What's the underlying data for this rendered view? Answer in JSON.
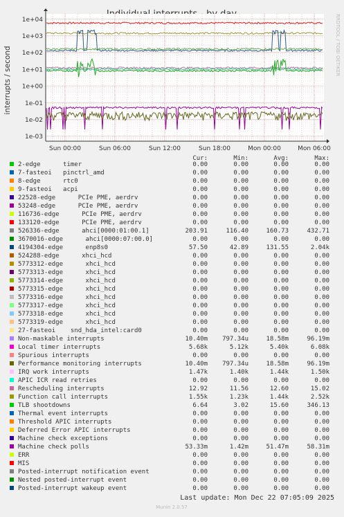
{
  "chart_data": {
    "type": "line",
    "title": "Individual interrupts - by day",
    "ylabel": "interrupts / second",
    "side_label": "RRDTOOL / TOBI OETIKER",
    "yscale": "log",
    "ylim": [
      0.0005,
      20000
    ],
    "y_ticks": [
      {
        "v": 10000,
        "label": "1e+04"
      },
      {
        "v": 1000,
        "label": "1e+03"
      },
      {
        "v": 100,
        "label": "1e+02"
      },
      {
        "v": 10,
        "label": "1e+01"
      },
      {
        "v": 1,
        "label": "1e+00"
      },
      {
        "v": 0.1,
        "label": "1e-01"
      },
      {
        "v": 0.01,
        "label": "1e-02"
      },
      {
        "v": 0.001,
        "label": "1e-03"
      }
    ],
    "x_ticks": [
      "Sun 00:00",
      "Sun 06:00",
      "Sun 12:00",
      "Sun 18:00",
      "Mon 00:00",
      "Mon 06:00"
    ],
    "grid": true,
    "series": [
      {
        "name": "Local timer interrupts",
        "color": "#e41a1c",
        "y_level": 5700
      },
      {
        "name": "Function call interrupts",
        "color": "#999933",
        "y_level": 1400
      },
      {
        "name": "enp8s0",
        "color": "#2a5890",
        "y_level": 130,
        "spike_to": 2000
      },
      {
        "name": "ahci[0000:01:00.1]",
        "color": "#66aa55",
        "y_level": 160
      },
      {
        "name": "Rescheduling interrupts",
        "color": "#c070a0",
        "y_level": 12
      },
      {
        "name": "TLB shootdowns",
        "color": "#33cc99",
        "y_level": 10
      },
      {
        "name": "Posted-interrupt notification event",
        "color": "#22aa22",
        "y_level": 8
      },
      {
        "name": "Machine check polls",
        "color": "#990099",
        "y_level": 0.05
      },
      {
        "name": "Performance monitoring interrupts",
        "color": "#666622",
        "y_level": 0.018
      }
    ]
  },
  "legend": {
    "headers": {
      "cur": "Cur:",
      "min": "Min:",
      "avg": "Avg:",
      "max": "Max:"
    },
    "rows": [
      {
        "label": "2-edge      timer",
        "color": "#00cc00",
        "cur": "0.00",
        "min": "0.00",
        "avg": "0.00",
        "max": "0.00"
      },
      {
        "label": "7-fasteoi   pinctrl_amd",
        "color": "#0066b3",
        "cur": "0.00",
        "min": "0.00",
        "avg": "0.00",
        "max": "0.00"
      },
      {
        "label": "8-edge      rtc0",
        "color": "#ff8000",
        "cur": "0.00",
        "min": "0.00",
        "avg": "0.00",
        "max": "0.00"
      },
      {
        "label": "9-fasteoi   acpi",
        "color": "#ffcc00",
        "cur": "0.00",
        "min": "0.00",
        "avg": "0.00",
        "max": "0.00"
      },
      {
        "label": "22528-edge      PCIe PME, aerdrv",
        "color": "#330099",
        "cur": "0.00",
        "min": "0.00",
        "avg": "0.00",
        "max": "0.00"
      },
      {
        "label": "53248-edge      PCIe PME, aerdrv",
        "color": "#990099",
        "cur": "0.00",
        "min": "0.00",
        "avg": "0.00",
        "max": "0.00"
      },
      {
        "label": "116736-edge      PCIe PME, aerdrv",
        "color": "#ccff00",
        "cur": "0.00",
        "min": "0.00",
        "avg": "0.00",
        "max": "0.00"
      },
      {
        "label": "133120-edge      PCIe PME, aerdrv",
        "color": "#ff0000",
        "cur": "0.00",
        "min": "0.00",
        "avg": "0.00",
        "max": "0.00"
      },
      {
        "label": "526336-edge      ahci[0000:01:00.1]",
        "color": "#808080",
        "cur": "203.91",
        "min": "116.40",
        "avg": "160.73",
        "max": "432.71"
      },
      {
        "label": "3670016-edge      ahci[0000:07:00.0]",
        "color": "#008f00",
        "cur": "0.00",
        "min": "0.00",
        "avg": "0.00",
        "max": "0.00"
      },
      {
        "label": "4194304-edge      enp8s0",
        "color": "#00487d",
        "cur": "57.50",
        "min": "42.89",
        "avg": "131.55",
        "max": "2.04k"
      },
      {
        "label": "524288-edge      xhci_hcd",
        "color": "#b35a00",
        "cur": "0.00",
        "min": "0.00",
        "avg": "0.00",
        "max": "0.00"
      },
      {
        "label": "5773312-edge      xhci_hcd",
        "color": "#b38f00",
        "cur": "0.00",
        "min": "0.00",
        "avg": "0.00",
        "max": "0.00"
      },
      {
        "label": "5773313-edge      xhci_hcd",
        "color": "#6b006b",
        "cur": "0.00",
        "min": "0.00",
        "avg": "0.00",
        "max": "0.00"
      },
      {
        "label": "5773314-edge      xhci_hcd",
        "color": "#8fb300",
        "cur": "0.00",
        "min": "0.00",
        "avg": "0.00",
        "max": "0.00"
      },
      {
        "label": "5773315-edge      xhci_hcd",
        "color": "#b30000",
        "cur": "0.00",
        "min": "0.00",
        "avg": "0.00",
        "max": "0.00"
      },
      {
        "label": "5773316-edge      xhci_hcd",
        "color": "#bebebe",
        "cur": "0.00",
        "min": "0.00",
        "avg": "0.00",
        "max": "0.00"
      },
      {
        "label": "5773317-edge      xhci_hcd",
        "color": "#80ff80",
        "cur": "0.00",
        "min": "0.00",
        "avg": "0.00",
        "max": "0.00"
      },
      {
        "label": "5773318-edge      xhci_hcd",
        "color": "#80c9ff",
        "cur": "0.00",
        "min": "0.00",
        "avg": "0.00",
        "max": "0.00"
      },
      {
        "label": "5773319-edge      xhci_hcd",
        "color": "#ffc080",
        "cur": "0.00",
        "min": "0.00",
        "avg": "0.00",
        "max": "0.00"
      },
      {
        "label": "27-fasteoi    snd_hda_intel:card0",
        "color": "#ffe680",
        "cur": "0.00",
        "min": "0.00",
        "avg": "0.00",
        "max": "0.00"
      },
      {
        "label": "Non-maskable interrupts",
        "color": "#aa80ff",
        "cur": "10.40m",
        "min": "797.34u",
        "avg": "18.58m",
        "max": "96.19m"
      },
      {
        "label": "Local timer interrupts",
        "color": "#ee00cc",
        "cur": "5.68k",
        "min": "5.12k",
        "avg": "5.40k",
        "max": "6.08k"
      },
      {
        "label": "Spurious interrupts",
        "color": "#ff8080",
        "cur": "0.00",
        "min": "0.00",
        "avg": "0.00",
        "max": "0.00"
      },
      {
        "label": "Performance monitoring interrupts",
        "color": "#666600",
        "cur": "10.40m",
        "min": "797.34u",
        "avg": "18.58m",
        "max": "96.19m"
      },
      {
        "label": "IRQ work interrupts",
        "color": "#ffbfff",
        "cur": "1.47k",
        "min": "1.40k",
        "avg": "1.44k",
        "max": "1.50k"
      },
      {
        "label": "APIC ICR read retries",
        "color": "#00ffcc",
        "cur": "0.00",
        "min": "0.00",
        "avg": "0.00",
        "max": "0.00"
      },
      {
        "label": "Rescheduling interrupts",
        "color": "#cc6699",
        "cur": "12.92",
        "min": "11.56",
        "avg": "12.60",
        "max": "15.02"
      },
      {
        "label": "Function call interrupts",
        "color": "#999900",
        "cur": "1.55k",
        "min": "1.23k",
        "avg": "1.44k",
        "max": "2.52k"
      },
      {
        "label": "TLB shootdowns",
        "color": "#00cc00",
        "cur": "6.64",
        "min": "3.02",
        "avg": "15.60",
        "max": "346.13"
      },
      {
        "label": "Thermal event interrupts",
        "color": "#0066b3",
        "cur": "0.00",
        "min": "0.00",
        "avg": "0.00",
        "max": "0.00"
      },
      {
        "label": "Threshold APIC interrupts",
        "color": "#ff8000",
        "cur": "0.00",
        "min": "0.00",
        "avg": "0.00",
        "max": "0.00"
      },
      {
        "label": "Deferred Error APIC interrupts",
        "color": "#ffcc00",
        "cur": "0.00",
        "min": "0.00",
        "avg": "0.00",
        "max": "0.00"
      },
      {
        "label": "Machine check exceptions",
        "color": "#330099",
        "cur": "0.00",
        "min": "0.00",
        "avg": "0.00",
        "max": "0.00"
      },
      {
        "label": "Machine check polls",
        "color": "#990099",
        "cur": "53.33m",
        "min": "1.42m",
        "avg": "51.47m",
        "max": "58.31m"
      },
      {
        "label": "ERR",
        "color": "#ccff00",
        "cur": "0.00",
        "min": "0.00",
        "avg": "0.00",
        "max": "0.00"
      },
      {
        "label": "MIS",
        "color": "#ff0000",
        "cur": "0.00",
        "min": "0.00",
        "avg": "0.00",
        "max": "0.00"
      },
      {
        "label": "Posted-interrupt notification event",
        "color": "#808080",
        "cur": "0.00",
        "min": "0.00",
        "avg": "0.00",
        "max": "0.00"
      },
      {
        "label": "Nested posted-interrupt event",
        "color": "#008f00",
        "cur": "0.00",
        "min": "0.00",
        "avg": "0.00",
        "max": "0.00"
      },
      {
        "label": "Posted-interrupt wakeup event",
        "color": "#00487d",
        "cur": "0.00",
        "min": "0.00",
        "avg": "0.00",
        "max": "0.00"
      }
    ]
  },
  "footer": {
    "last_update": "Last update: Mon Dec 22 07:05:09 2025",
    "munin_version": "Munin 2.0.57"
  }
}
